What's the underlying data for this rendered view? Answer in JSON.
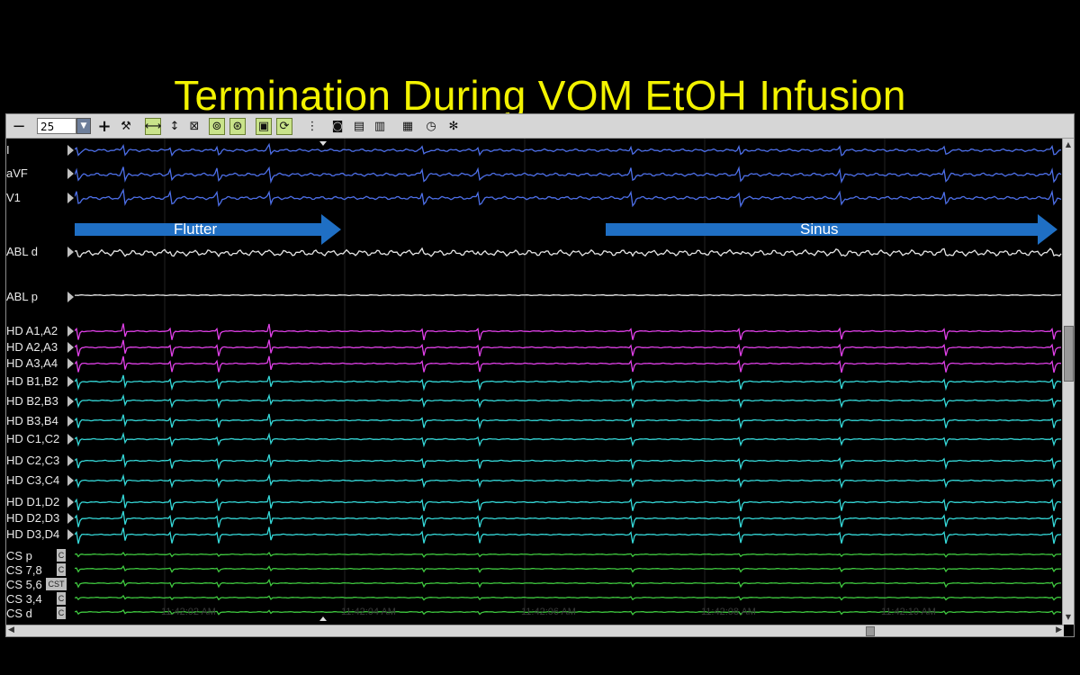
{
  "slide": {
    "title": "Termination During VOM EtOH Infusion"
  },
  "toolbar": {
    "minus": "−",
    "zoom_value": "25",
    "plus": "+"
  },
  "channels": [
    {
      "label": "I"
    },
    {
      "label": "aVF"
    },
    {
      "label": "V1"
    },
    {
      "label": "ABL d"
    },
    {
      "label": "ABL p"
    },
    {
      "label": "HD A1,A2"
    },
    {
      "label": "HD A2,A3"
    },
    {
      "label": "HD A3,A4"
    },
    {
      "label": "HD B1,B2"
    },
    {
      "label": "HD B2,B3"
    },
    {
      "label": "HD B3,B4"
    },
    {
      "label": "HD C1,C2"
    },
    {
      "label": "HD C2,C3"
    },
    {
      "label": "HD C3,C4"
    },
    {
      "label": "HD D1,D2"
    },
    {
      "label": "HD D2,D3"
    },
    {
      "label": "HD D3,D4"
    },
    {
      "label": "CS p"
    },
    {
      "label": "CS 7,8"
    },
    {
      "label": "CS 5,6"
    },
    {
      "label": "CS 3,4"
    },
    {
      "label": "CS d"
    }
  ],
  "cs_markers": {
    "box": "C",
    "boxes_56": "CST"
  },
  "annotations": {
    "flutter": "Flutter",
    "sinus": "Sinus"
  },
  "time_labels": [
    "11:42:02 AM",
    "11:42:04 AM",
    "11:42:06 AM",
    "11:42:08 AM",
    "11:42:10 AM"
  ],
  "colors": {
    "title": "#f3f300",
    "surface_ecg": "#4d6fe8",
    "abl": "#e8e8e8",
    "hd_a": "#e040e8",
    "hd_bcd": "#35d8d8",
    "cs": "#3fc83f",
    "arrow": "#1f6fc4"
  },
  "icons": [
    "wrench-icon",
    "hspread-icon",
    "vspread-icon",
    "calipers-icon",
    "marker-icon",
    "marker2-icon",
    "monitor-icon",
    "sync-icon",
    "branch-icon",
    "camera-icon",
    "printer-icon",
    "print2-icon",
    "grid-icon",
    "clock-icon",
    "gear-icon"
  ]
}
